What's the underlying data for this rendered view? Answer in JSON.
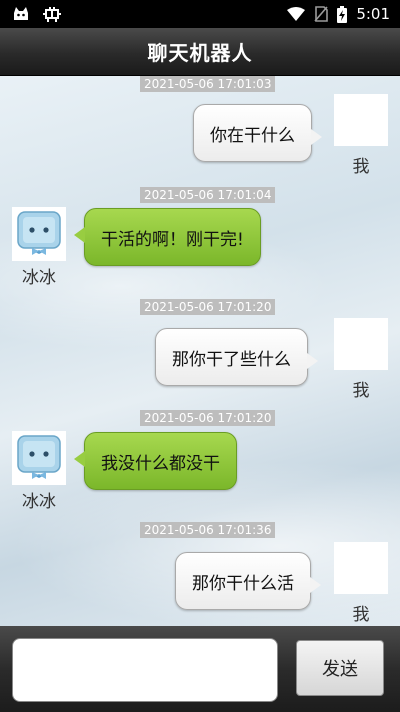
{
  "status_bar": {
    "left_icon": "bug-icon",
    "time": "5:01",
    "icons": [
      "wifi-icon",
      "no-sim-icon",
      "battery-charging-icon"
    ]
  },
  "title_bar": {
    "title": "聊天机器人"
  },
  "me_name": "我",
  "bot_name": "冰冰",
  "messages": [
    {
      "time": "2021-05-06 17:01:03",
      "sender": "me",
      "text": "你在干什么"
    },
    {
      "time": "2021-05-06 17:01:04",
      "sender": "bot",
      "text": "干活的啊！刚干完!"
    },
    {
      "time": "2021-05-06 17:01:20",
      "sender": "me",
      "text": "那你干了些什么"
    },
    {
      "time": "2021-05-06 17:01:20",
      "sender": "bot",
      "text": "我没什么都没干"
    },
    {
      "time": "2021-05-06 17:01:36",
      "sender": "me",
      "text": "那你干什么活"
    }
  ],
  "input_bar": {
    "input_value": "",
    "send_label": "发送"
  },
  "colors": {
    "bot_bubble": "#8cc63f",
    "me_bubble": "#f5f5f5",
    "timestamp_bg": "#bdbdbd",
    "bar_dark": "#2a2a2a"
  }
}
